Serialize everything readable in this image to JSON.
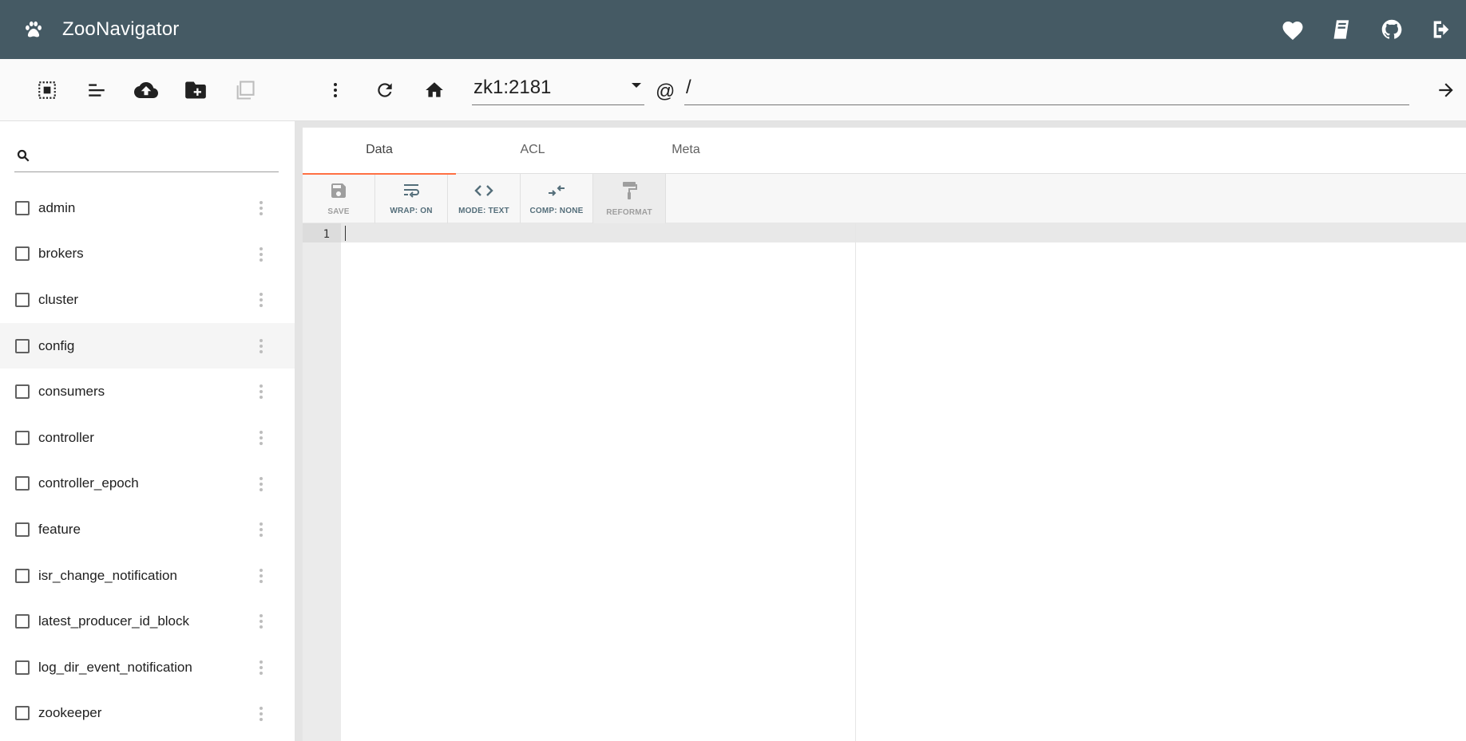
{
  "app": {
    "title": "ZooNavigator"
  },
  "header_actions": [
    {
      "name": "heart-icon"
    },
    {
      "name": "book-icon"
    },
    {
      "name": "github-icon"
    },
    {
      "name": "logout-icon"
    }
  ],
  "left_toolbar": [
    {
      "name": "select-all-icon"
    },
    {
      "name": "sort-icon"
    },
    {
      "name": "upload-icon"
    },
    {
      "name": "create-folder-icon"
    },
    {
      "name": "duplicate-icon"
    }
  ],
  "search": {
    "placeholder": "",
    "value": ""
  },
  "tree": {
    "nodes": [
      "admin",
      "brokers",
      "cluster",
      "config",
      "consumers",
      "controller",
      "controller_epoch",
      "feature",
      "isr_change_notification",
      "latest_producer_id_block",
      "log_dir_event_notification",
      "zookeeper"
    ],
    "hovered": "config"
  },
  "path_bar": {
    "connection": "zk1:2181",
    "at": "@",
    "path": "/"
  },
  "tabs": [
    "Data",
    "ACL",
    "Meta"
  ],
  "active_tab": "Data",
  "editor_toolbar": [
    {
      "label": "SAVE",
      "icon": "save-icon",
      "state": "disabled"
    },
    {
      "label": "WRAP: ON",
      "icon": "wrap-icon",
      "state": "enabled"
    },
    {
      "label": "MODE: TEXT",
      "icon": "code-icon",
      "state": "enabled"
    },
    {
      "label": "COMP: NONE",
      "icon": "compress-icon",
      "state": "enabled"
    },
    {
      "label": "REFORMAT",
      "icon": "paint-roller-icon",
      "state": "disabled"
    }
  ],
  "editor": {
    "line_numbers": [
      "1"
    ],
    "content": ""
  },
  "colors": {
    "appbar": "#455a64",
    "tab_indicator": "#ff7043",
    "toolbar_label": "#546e7a"
  }
}
